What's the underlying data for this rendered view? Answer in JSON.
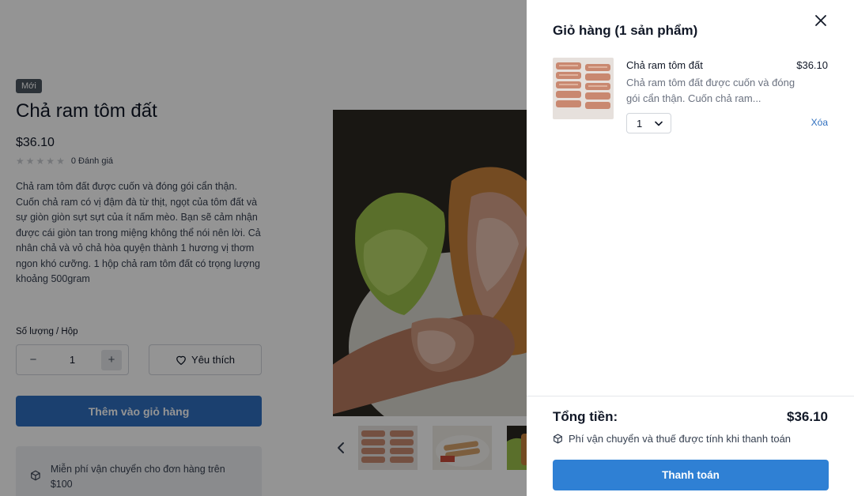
{
  "product": {
    "badge": "Mới",
    "title": "Chả ram tôm đất",
    "price": "$36.10",
    "rating_stars": 0,
    "rating_text": "0 Đánh giá",
    "description": "Chả ram tôm đất được cuốn và đóng gói cẩn thận. Cuốn chả ram có vị đậm đà từ thịt, ngọt của tôm đất và sự giòn giòn sựt sựt của ít nấm mèo. Bạn sẽ cảm nhận được cái giòn tan trong miệng không thể nói nên lời. Cả nhân chả và vỏ chả hòa quyện thành 1 hương vị thơm ngon khó cưỡng. 1 hộp chả ram tôm đất có trọng lượng khoảng 500gram",
    "quantity_label": "Số lượng / Hộp",
    "quantity_value": "1",
    "favorite_label": "Yêu thích",
    "add_to_cart_label": "Thêm vào giỏ hàng",
    "shipping_note": "Miễn phí vận chuyển cho đơn hàng trên $100"
  },
  "cart": {
    "title": "Giỏ hàng (1 sản phẩm)",
    "items": [
      {
        "name": "Chả ram tôm đất",
        "price": "$36.10",
        "description": "Chả ram tôm đất được cuốn và đóng gói cẩn thận. Cuốn chả ram...",
        "quantity": "1",
        "remove_label": "Xóa"
      }
    ],
    "total_label": "Tổng tiền:",
    "total_value": "$36.10",
    "tax_note": "Phí vận chuyển và thuế được tính khi thanh toán",
    "checkout_label": "Thanh toán"
  },
  "icons": {
    "close": "close-icon",
    "heart": "heart-icon",
    "box": "box-icon",
    "chevron_left": "chevron-left-icon",
    "chevron_down": "chevron-down-icon"
  },
  "colors": {
    "primary": "#2f80d4",
    "overlay": "rgba(0,0,0,0.42)"
  }
}
